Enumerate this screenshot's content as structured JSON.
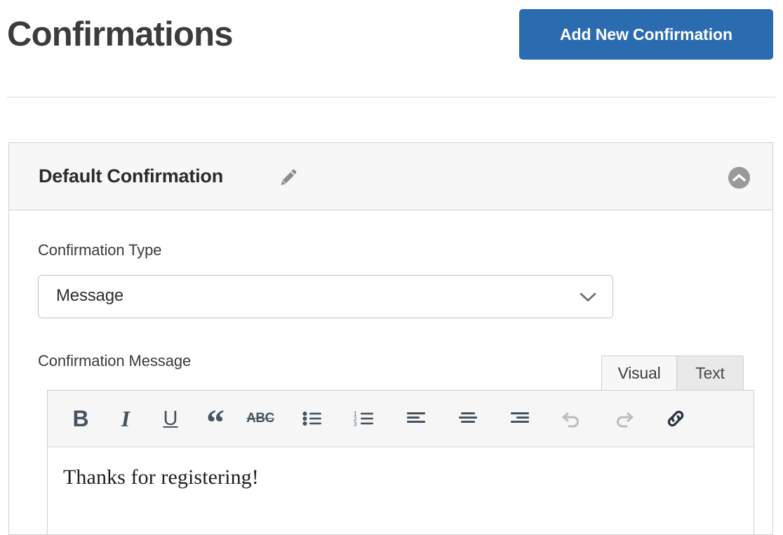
{
  "header": {
    "title": "Confirmations",
    "add_button_label": "Add New Confirmation",
    "accent_color": "#2b6cb0"
  },
  "panel": {
    "title": "Default Confirmation",
    "edit_icon": "pencil-icon",
    "collapse_icon": "chevron-up-circle-icon",
    "fields": {
      "confirmation_type": {
        "label": "Confirmation Type",
        "value": "Message",
        "chevron": "chevron-down-icon"
      },
      "confirmation_message": {
        "label": "Confirmation Message",
        "tabs": [
          {
            "label": "Visual",
            "active": true
          },
          {
            "label": "Text",
            "active": false
          }
        ],
        "toolbar": [
          {
            "name": "bold-icon",
            "glyph": "B"
          },
          {
            "name": "italic-icon",
            "glyph": "I"
          },
          {
            "name": "underline-icon",
            "glyph": "U"
          },
          {
            "name": "blockquote-icon",
            "glyph": "“"
          },
          {
            "name": "strikethrough-icon",
            "glyph": "ABC"
          },
          {
            "name": "bulleted-list-icon",
            "glyph": ""
          },
          {
            "name": "numbered-list-icon",
            "glyph": ""
          },
          {
            "name": "align-left-icon",
            "glyph": ""
          },
          {
            "name": "align-center-icon",
            "glyph": ""
          },
          {
            "name": "align-right-icon",
            "glyph": ""
          },
          {
            "name": "undo-icon",
            "glyph": ""
          },
          {
            "name": "redo-icon",
            "glyph": ""
          },
          {
            "name": "insert-link-icon",
            "glyph": ""
          }
        ],
        "content": "Thanks for registering!"
      }
    }
  }
}
